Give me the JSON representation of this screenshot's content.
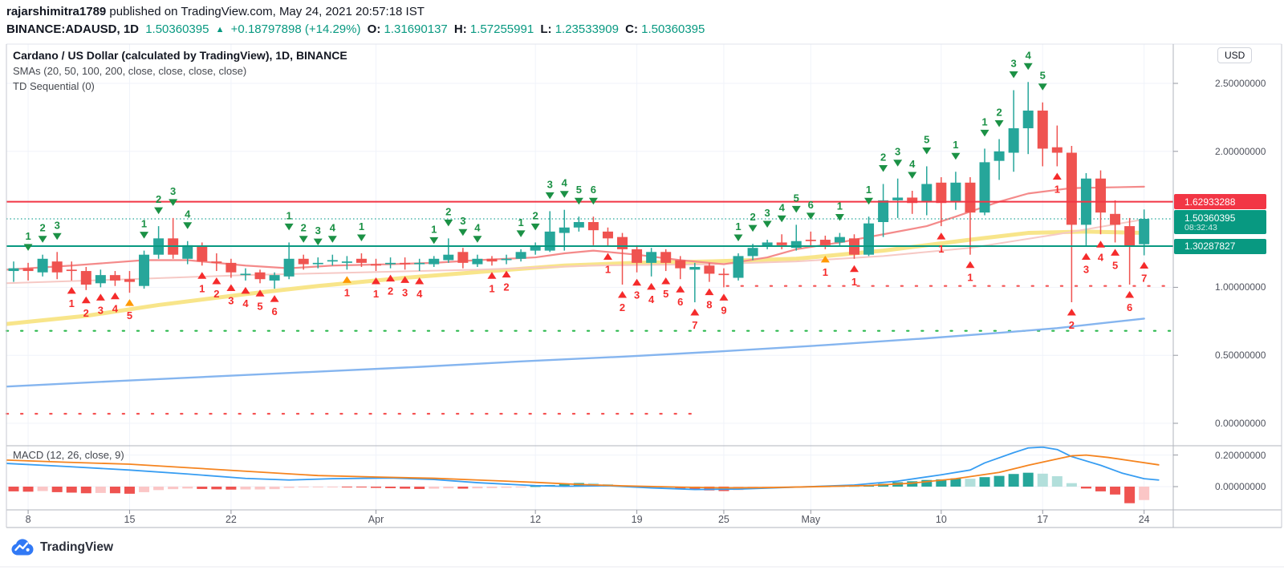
{
  "header": {
    "published_line": {
      "username": "rajarshimitra1789",
      "rest": " published on TradingView.com, May 24, 2021 20:57:18 IST"
    },
    "symbol_line": {
      "symbol": "BINANCE:ADAUSD, 1D",
      "last": "1.50360395",
      "direction_icon": "▲",
      "change": "+0.18797898 (+14.29%)",
      "o_label": "O:",
      "o": "1.31690137",
      "h_label": "H:",
      "h": "1.57255991",
      "l_label": "L:",
      "l": "1.23533909",
      "c_label": "C:",
      "c": "1.50360395",
      "up_color": "#089981"
    }
  },
  "legend": {
    "title": "Cardano / US Dollar (calculated by TradingView), 1D, BINANCE",
    "smas": "SMAs (20, 50, 100, 200, close, close, close, close)",
    "td": "TD Sequential (0)"
  },
  "price_axis": {
    "currency": "USD",
    "ticks": [
      "2.50000000",
      "2.00000000",
      "1.00000000",
      "0.50000000",
      "0.00000000"
    ],
    "tags": [
      {
        "text": "1.62933288",
        "bg": "#f23645"
      },
      {
        "text": "1.50360395",
        "sub": "08:32:43",
        "bg": "#089981"
      },
      {
        "text": "1.30287827",
        "bg": "#089981"
      }
    ]
  },
  "time_axis": {
    "labels": [
      {
        "text": "8",
        "i": 1
      },
      {
        "text": "15",
        "i": 8
      },
      {
        "text": "22",
        "i": 15
      },
      {
        "text": "Apr",
        "i": 25
      },
      {
        "text": "12",
        "i": 36
      },
      {
        "text": "19",
        "i": 43
      },
      {
        "text": "25",
        "i": 49
      },
      {
        "text": "May",
        "i": 55
      },
      {
        "text": "10",
        "i": 64
      },
      {
        "text": "17",
        "i": 71
      },
      {
        "text": "24",
        "i": 78
      }
    ]
  },
  "macd_panel": {
    "label": "MACD (12, 26, close, 9)",
    "ticks": [
      "0.20000000",
      "0.00000000"
    ]
  },
  "footer": {
    "brand": "TradingView"
  },
  "chart_data": {
    "type": "candlestick+macd",
    "title": "Cardano / US Dollar (calculated by TradingView), 1D, BINANCE",
    "symbol": "BINANCE:ADAUSD",
    "interval": "1D",
    "price_axis_range": [
      -0.16,
      2.79
    ],
    "macd_axis_range": [
      -0.14,
      0.26
    ],
    "grid": true,
    "colors": {
      "up": "#26a69a",
      "down": "#ef5350",
      "level_red": "#f23645",
      "level_teal": "#089981",
      "price_dotted": "#26a69a",
      "td_green": "#1b9145",
      "td_red": "#f52b2b",
      "td_orange": "#ff9800",
      "td_dot_green": "#2bb84d",
      "td_dot_red": "#f55353",
      "sma20": "#f48a8a",
      "sma50": "#f6c9c5",
      "sma100": "#f8e58a",
      "sma200": "#85b5ef",
      "macd_line": "#379df2",
      "signal_line": "#f5841f",
      "hist_pos": "#26a69a",
      "hist_pos_pale": "#b2dfdb",
      "hist_neg": "#ef5350",
      "hist_neg_pale": "#fbc6c6"
    },
    "candles_note": "daily candles Mar 7 - May 24 2021; values [open,high,low,close,td_mark]; td g=green above, r=red below, o=red count with orange arrow",
    "candles": [
      [
        1.12,
        1.19,
        1.04,
        1.14,
        ""
      ],
      [
        1.14,
        1.18,
        1.05,
        1.12,
        "g1"
      ],
      [
        1.11,
        1.24,
        1.08,
        1.21,
        "g2"
      ],
      [
        1.19,
        1.26,
        1.06,
        1.11,
        "g3"
      ],
      [
        1.13,
        1.19,
        1.05,
        1.12,
        "r1"
      ],
      [
        1.12,
        1.15,
        0.98,
        1.02,
        "r2"
      ],
      [
        1.03,
        1.13,
        1.0,
        1.09,
        "r3"
      ],
      [
        1.09,
        1.12,
        1.01,
        1.05,
        "r4"
      ],
      [
        1.06,
        1.12,
        0.96,
        1.04,
        "o5"
      ],
      [
        1.01,
        1.27,
        0.99,
        1.24,
        "g1"
      ],
      [
        1.24,
        1.45,
        1.21,
        1.36,
        "g2"
      ],
      [
        1.36,
        1.51,
        1.21,
        1.24,
        "g3"
      ],
      [
        1.21,
        1.34,
        1.17,
        1.31,
        "g4"
      ],
      [
        1.3,
        1.33,
        1.16,
        1.19,
        "r1"
      ],
      [
        1.19,
        1.25,
        1.12,
        1.18,
        "r2"
      ],
      [
        1.18,
        1.21,
        1.07,
        1.11,
        "r3"
      ],
      [
        1.09,
        1.14,
        1.05,
        1.1,
        "r4"
      ],
      [
        1.11,
        1.13,
        1.03,
        1.06,
        "r5"
      ],
      [
        1.05,
        1.11,
        0.99,
        1.09,
        "r6"
      ],
      [
        1.08,
        1.33,
        1.06,
        1.21,
        "g1"
      ],
      [
        1.21,
        1.24,
        1.13,
        1.17,
        "g2"
      ],
      [
        1.17,
        1.22,
        1.14,
        1.18,
        "g3"
      ],
      [
        1.19,
        1.24,
        1.16,
        1.2,
        "g4"
      ],
      [
        1.18,
        1.23,
        1.13,
        1.19,
        "o1"
      ],
      [
        1.21,
        1.25,
        1.15,
        1.18,
        "g1"
      ],
      [
        1.17,
        1.21,
        1.12,
        1.16,
        "r1"
      ],
      [
        1.17,
        1.22,
        1.14,
        1.18,
        "r2"
      ],
      [
        1.18,
        1.22,
        1.13,
        1.17,
        "r3"
      ],
      [
        1.17,
        1.21,
        1.12,
        1.18,
        "r4"
      ],
      [
        1.17,
        1.23,
        1.15,
        1.21,
        "g1"
      ],
      [
        1.2,
        1.36,
        1.18,
        1.24,
        "g2"
      ],
      [
        1.26,
        1.29,
        1.14,
        1.18,
        "g3"
      ],
      [
        1.17,
        1.24,
        1.15,
        1.21,
        "g4"
      ],
      [
        1.21,
        1.23,
        1.16,
        1.19,
        "r1"
      ],
      [
        1.2,
        1.24,
        1.17,
        1.21,
        "r2"
      ],
      [
        1.21,
        1.28,
        1.19,
        1.26,
        "g1"
      ],
      [
        1.27,
        1.33,
        1.24,
        1.3,
        "g2"
      ],
      [
        1.27,
        1.56,
        1.26,
        1.41,
        "g3"
      ],
      [
        1.4,
        1.57,
        1.27,
        1.44,
        "g4"
      ],
      [
        1.44,
        1.52,
        1.41,
        1.48,
        "g5"
      ],
      [
        1.48,
        1.52,
        1.31,
        1.42,
        "g6"
      ],
      [
        1.41,
        1.44,
        1.3,
        1.36,
        "r1"
      ],
      [
        1.37,
        1.4,
        1.02,
        1.28,
        "r2"
      ],
      [
        1.28,
        1.31,
        1.11,
        1.18,
        "r3"
      ],
      [
        1.18,
        1.29,
        1.08,
        1.26,
        "r4"
      ],
      [
        1.26,
        1.28,
        1.12,
        1.18,
        "r5"
      ],
      [
        1.2,
        1.23,
        1.06,
        1.14,
        "r6"
      ],
      [
        1.13,
        1.18,
        0.89,
        1.15,
        "r7"
      ],
      [
        1.16,
        1.18,
        1.04,
        1.1,
        "r8"
      ],
      [
        1.1,
        1.14,
        1.0,
        1.09,
        "r9"
      ],
      [
        1.07,
        1.25,
        1.05,
        1.23,
        "g1"
      ],
      [
        1.23,
        1.32,
        1.2,
        1.29,
        "g2"
      ],
      [
        1.3,
        1.35,
        1.28,
        1.33,
        "g3"
      ],
      [
        1.33,
        1.39,
        1.28,
        1.31,
        "g4"
      ],
      [
        1.29,
        1.46,
        1.27,
        1.34,
        "g5"
      ],
      [
        1.35,
        1.41,
        1.3,
        1.34,
        "g6"
      ],
      [
        1.35,
        1.38,
        1.28,
        1.31,
        "o1"
      ],
      [
        1.33,
        1.4,
        1.3,
        1.37,
        "g1"
      ],
      [
        1.36,
        1.39,
        1.21,
        1.24,
        "r1"
      ],
      [
        1.24,
        1.52,
        1.23,
        1.47,
        "g1"
      ],
      [
        1.48,
        1.76,
        1.37,
        1.64,
        "g2"
      ],
      [
        1.64,
        1.8,
        1.51,
        1.66,
        "g3"
      ],
      [
        1.66,
        1.71,
        1.54,
        1.62,
        "g4"
      ],
      [
        1.63,
        1.89,
        1.53,
        1.76,
        "g5"
      ],
      [
        1.77,
        1.81,
        1.45,
        1.62,
        "r1"
      ],
      [
        1.63,
        1.85,
        1.57,
        1.77,
        "g1"
      ],
      [
        1.77,
        1.81,
        1.24,
        1.55,
        "r1"
      ],
      [
        1.55,
        2.02,
        1.53,
        1.92,
        "g1"
      ],
      [
        1.93,
        2.09,
        1.79,
        2.0,
        "g2"
      ],
      [
        1.99,
        2.45,
        1.85,
        2.17,
        "g3"
      ],
      [
        2.17,
        2.51,
        1.98,
        2.3,
        "g4"
      ],
      [
        2.3,
        2.36,
        1.89,
        2.02,
        "g5"
      ],
      [
        2.03,
        2.19,
        1.89,
        1.99,
        "r1"
      ],
      [
        1.99,
        2.04,
        0.89,
        1.46,
        "r2"
      ],
      [
        1.46,
        1.84,
        1.3,
        1.8,
        "r3"
      ],
      [
        1.8,
        1.86,
        1.39,
        1.55,
        "r4"
      ],
      [
        1.54,
        1.64,
        1.33,
        1.46,
        "r5"
      ],
      [
        1.45,
        1.51,
        1.02,
        1.3,
        "r6"
      ],
      [
        1.31690137,
        1.57255991,
        1.23533909,
        1.50360395,
        "r7"
      ]
    ],
    "levels": [
      {
        "price": 1.62933288,
        "style": "solid",
        "color": "#f23645"
      },
      {
        "price": 1.30287827,
        "style": "solid",
        "color": "#089981"
      },
      {
        "price": 1.50360395,
        "style": "dotted",
        "color": "#26a69a"
      }
    ],
    "td_dotted_lines": [
      {
        "price": 0.68,
        "from": -0.5,
        "to": 79.9,
        "color": "green"
      },
      {
        "price": 0.07,
        "from": -0.5,
        "to": 47.1,
        "color": "red"
      },
      {
        "price": 1.01,
        "from": 49.2,
        "to": 79.9,
        "color": "red"
      }
    ],
    "smas": {
      "sma20": [
        [
          -0.5,
          1.13
        ],
        [
          4,
          1.16
        ],
        [
          9,
          1.2
        ],
        [
          12,
          1.2
        ],
        [
          16,
          1.16
        ],
        [
          19,
          1.14
        ],
        [
          22,
          1.16
        ],
        [
          26,
          1.17
        ],
        [
          29,
          1.18
        ],
        [
          32,
          1.2
        ],
        [
          36,
          1.22
        ],
        [
          38,
          1.25
        ],
        [
          40,
          1.27
        ],
        [
          43,
          1.24
        ],
        [
          46,
          1.2
        ],
        [
          49,
          1.17
        ],
        [
          52,
          1.22
        ],
        [
          54,
          1.28
        ],
        [
          57,
          1.33
        ],
        [
          60,
          1.39
        ],
        [
          63,
          1.45
        ],
        [
          65,
          1.52
        ],
        [
          68,
          1.63
        ],
        [
          70,
          1.69
        ],
        [
          73,
          1.73
        ],
        [
          78,
          1.74
        ]
      ],
      "sma50": [
        [
          -0.5,
          1.03
        ],
        [
          8,
          1.06
        ],
        [
          16,
          1.09
        ],
        [
          24,
          1.11
        ],
        [
          32,
          1.13
        ],
        [
          40,
          1.16
        ],
        [
          48,
          1.17
        ],
        [
          54,
          1.19
        ],
        [
          60,
          1.23
        ],
        [
          66,
          1.29
        ],
        [
          72,
          1.39
        ],
        [
          78,
          1.5
        ]
      ],
      "sma100": [
        [
          -0.5,
          0.73
        ],
        [
          5,
          0.79
        ],
        [
          10,
          0.87
        ],
        [
          16,
          0.95
        ],
        [
          21,
          1.01
        ],
        [
          27,
          1.07
        ],
        [
          33,
          1.12
        ],
        [
          38,
          1.16
        ],
        [
          43,
          1.18
        ],
        [
          48,
          1.19
        ],
        [
          54,
          1.21
        ],
        [
          60,
          1.27
        ],
        [
          66,
          1.35
        ],
        [
          70,
          1.4
        ],
        [
          74,
          1.41
        ],
        [
          78,
          1.4
        ]
      ],
      "sma200": [
        [
          -0.5,
          0.27
        ],
        [
          7,
          0.31
        ],
        [
          14,
          0.345
        ],
        [
          21,
          0.38
        ],
        [
          28,
          0.415
        ],
        [
          35,
          0.455
        ],
        [
          42,
          0.49
        ],
        [
          49,
          0.53
        ],
        [
          56,
          0.575
        ],
        [
          63,
          0.625
        ],
        [
          68,
          0.665
        ],
        [
          72,
          0.7
        ],
        [
          75,
          0.735
        ],
        [
          78,
          0.77
        ]
      ]
    },
    "macd": {
      "histogram": [
        -0.03,
        -0.032,
        -0.028,
        -0.035,
        -0.038,
        -0.042,
        -0.04,
        -0.042,
        -0.045,
        -0.035,
        -0.022,
        -0.016,
        -0.012,
        -0.015,
        -0.017,
        -0.019,
        -0.018,
        -0.018,
        -0.016,
        -0.008,
        -0.005,
        -0.003,
        -0.002,
        -0.003,
        -0.005,
        -0.008,
        -0.01,
        -0.013,
        -0.015,
        -0.013,
        -0.011,
        -0.013,
        -0.011,
        -0.009,
        -0.007,
        -0.003,
        0.003,
        0.01,
        0.018,
        0.023,
        0.022,
        0.016,
        0.008,
        0.003,
        0.002,
        -0.004,
        -0.012,
        -0.018,
        -0.024,
        -0.028,
        -0.022,
        -0.014,
        -0.008,
        -0.004,
        0.0,
        0.002,
        0.002,
        0.004,
        0.002,
        0.008,
        0.018,
        0.028,
        0.034,
        0.042,
        0.046,
        0.052,
        0.05,
        0.06,
        0.068,
        0.08,
        0.088,
        0.082,
        0.066,
        0.022,
        -0.012,
        -0.03,
        -0.05,
        -0.105,
        -0.085
      ],
      "macd_line": [
        [
          -0.5,
          0.147
        ],
        [
          3.5,
          0.128
        ],
        [
          8,
          0.105
        ],
        [
          12,
          0.08
        ],
        [
          16,
          0.052
        ],
        [
          19,
          0.042
        ],
        [
          22,
          0.05
        ],
        [
          26,
          0.055
        ],
        [
          29,
          0.045
        ],
        [
          32,
          0.025
        ],
        [
          36,
          0.006
        ],
        [
          38,
          0.002
        ],
        [
          41,
          0.006
        ],
        [
          44,
          -0.008
        ],
        [
          47,
          -0.018
        ],
        [
          50,
          -0.016
        ],
        [
          53,
          -0.006
        ],
        [
          55,
          0.0
        ],
        [
          58,
          0.01
        ],
        [
          61,
          0.035
        ],
        [
          64,
          0.075
        ],
        [
          66,
          0.105
        ],
        [
          67,
          0.15
        ],
        [
          69,
          0.215
        ],
        [
          70,
          0.245
        ],
        [
          71,
          0.25
        ],
        [
          72,
          0.235
        ],
        [
          73,
          0.19
        ],
        [
          75,
          0.135
        ],
        [
          76.5,
          0.085
        ],
        [
          78,
          0.05
        ],
        [
          79,
          0.042
        ]
      ],
      "signal_line": [
        [
          -0.5,
          0.168
        ],
        [
          3.5,
          0.155
        ],
        [
          8,
          0.142
        ],
        [
          12,
          0.12
        ],
        [
          17,
          0.092
        ],
        [
          21,
          0.07
        ],
        [
          25,
          0.061
        ],
        [
          29,
          0.053
        ],
        [
          32,
          0.042
        ],
        [
          36,
          0.027
        ],
        [
          39,
          0.014
        ],
        [
          42,
          0.005
        ],
        [
          46,
          -0.003
        ],
        [
          49,
          -0.008
        ],
        [
          52,
          -0.006
        ],
        [
          55,
          -0.001
        ],
        [
          59,
          0.007
        ],
        [
          62,
          0.022
        ],
        [
          65,
          0.05
        ],
        [
          68,
          0.09
        ],
        [
          70,
          0.135
        ],
        [
          72,
          0.175
        ],
        [
          73,
          0.195
        ],
        [
          74,
          0.2
        ],
        [
          75.5,
          0.185
        ],
        [
          77,
          0.165
        ],
        [
          79,
          0.138
        ]
      ]
    }
  }
}
